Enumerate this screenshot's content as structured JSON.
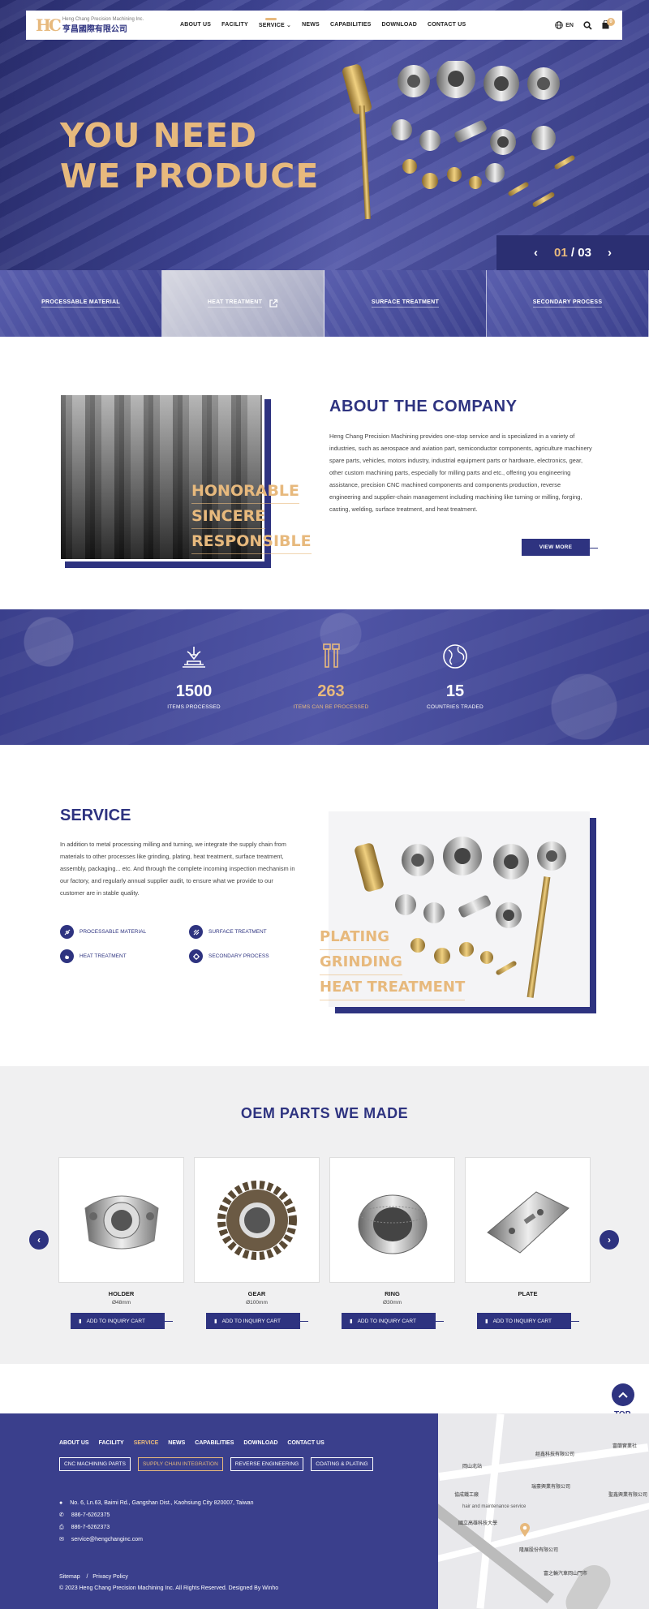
{
  "header": {
    "logo_mark": "HC",
    "logo_en": "Heng Chang Precision Machining Inc.",
    "logo_cn": "亨昌國際有限公司",
    "nav": [
      "ABOUT US",
      "FACILITY",
      "SERVICE",
      "NEWS",
      "CAPABILITIES",
      "DOWNLOAD",
      "CONTACT US"
    ],
    "lang": "EN",
    "cart_count": "0"
  },
  "hero": {
    "title_line1": "YOU NEED",
    "title_line2": "WE PRODUCE",
    "slide_current": "01",
    "slide_sep": " / ",
    "slide_total": "03",
    "quick_links": [
      "PROCESSABLE MATERIAL",
      "HEAT TREATMENT",
      "SURFACE TREATMENT",
      "SECONDARY PROCESS"
    ]
  },
  "about": {
    "title": "ABOUT THE COMPANY",
    "motto": [
      "HONORABLE",
      "SINCERE",
      "RESPONSIBLE"
    ],
    "body": "Heng Chang Precision Machining provides one-stop service and is specialized in a variety of industries, such as aerospace and aviation part, semiconductor components, agriculture machinery spare parts, vehicles, motors industry, industrial equipment parts or hardware, electronics, gear, other custom machining parts, especially for milling parts and etc., offering you engineering assistance, precision CNC machined components and components production, reverse engineering and supplier-chain management including machining like turning or milling, forging, casting, welding, surface treatment, and heat treatment.",
    "button": "VIEW MORE"
  },
  "stats": [
    {
      "value": "1500",
      "label": "ITEMS PROCESSED"
    },
    {
      "value": "263",
      "label": "ITEMS CAN BE PROCESSED"
    },
    {
      "value": "15",
      "label": "COUNTRIES TRADED"
    }
  ],
  "service": {
    "title": "SERVICE",
    "body": "In addition to metal processing milling and turning, we integrate the supply chain from materials to other processes like grinding, plating, heat treatment, surface treatment, assembly, packaging... etc. And through the complete incoming inspection mechanism in our factory, and regularly annual supplier audit, to ensure what we provide to our customer are in stable quality.",
    "items": [
      "PROCESSABLE MATERIAL",
      "SURFACE TREATMENT",
      "HEAT TREATMENT",
      "SECONDARY PROCESS"
    ],
    "motto": [
      "PLATING",
      "GRINDING",
      "HEAT TREATMENT"
    ]
  },
  "oem": {
    "title": "OEM PARTS WE MADE",
    "button": "ADD TO INQUIRY CART",
    "products": [
      {
        "name": "HOLDER",
        "spec": "Ø48mm"
      },
      {
        "name": "GEAR",
        "spec": "Ø100mm"
      },
      {
        "name": "RING",
        "spec": "Ø30mm"
      },
      {
        "name": "PLATE",
        "spec": ""
      }
    ]
  },
  "top_label": "TOP",
  "footer": {
    "nav": [
      "ABOUT US",
      "FACILITY",
      "SERVICE",
      "NEWS",
      "CAPABILITIES",
      "DOWNLOAD",
      "CONTACT US"
    ],
    "tags": [
      "CNC MACHINING PARTS",
      "SUPPLY CHAIN INTEGRATION",
      "REVERSE ENGINEERING",
      "COATING & PLATING"
    ],
    "address": "No. 6, Ln.63, Baimi Rd., Gangshan Dist., Kaohsiung City 820007, Taiwan",
    "phone": "886-7-6262375",
    "fax": "886-7-6262373",
    "email": "service@hengchanginc.com",
    "sitemap": "Sitemap",
    "privacy": "Privacy Policy",
    "copyright": "© 2023  Heng Chang Precision Machining Inc. All Rights Reserved. Designed By Winho"
  },
  "map": {
    "labels": [
      "經鑫科技有限公司",
      "富蘭實業社",
      "岡山北站",
      "瑞豪興業有限公司",
      "聖鑫興業有限公司",
      "協成鐵工廠",
      "hair and maintenance service",
      "國立高雄科技大學",
      "隆展股份有限公司",
      "富之輪汽車岡山門市"
    ]
  },
  "colors": {
    "navy": "#2e3380",
    "gold": "#e7b97d"
  }
}
